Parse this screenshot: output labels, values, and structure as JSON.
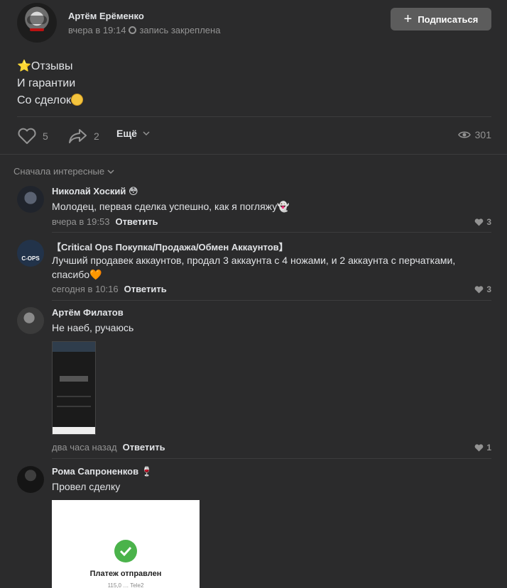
{
  "post": {
    "author": "Артём Ерёменко",
    "time": "вчера в 19:14",
    "pinned": "запись закреплена",
    "subscribe_label": "Подписаться",
    "text_lines": [
      "⭐Отзывы",
      "И гарантии",
      "Со сделок"
    ],
    "likes": "5",
    "shares": "2",
    "more_label": "Ещё",
    "views": "301"
  },
  "sort_label": "Сначала интересные",
  "comments": [
    {
      "name": "Николай Хоский 😳",
      "text": "Молодец, первая сделка успешно, как я погляжу👻",
      "time": "вчера в 19:53",
      "reply": "Ответить",
      "likes": "3"
    },
    {
      "name": "【Critical Ops Покупка/Продажа/Обмен Аккаунтов】",
      "text": "Лучший продавек аккаунтов, продал 3 аккаунта с 4 ножами, и 2 аккаунта с перчатками, спасибо🧡",
      "time": "сегодня в 10:16",
      "reply": "Ответить",
      "likes": "3",
      "avatar_text": "C-OPS"
    },
    {
      "name": "Артём Филатов",
      "text": "Не наеб, ручаюсь",
      "time": "два часа назад",
      "reply": "Ответить",
      "likes": "1"
    },
    {
      "name": "Рома Сапроненков 🍷",
      "text": "Провел сделку",
      "image_title": "Платеж отправлен",
      "image_sub": "115,0 … Tele2"
    }
  ],
  "colors": {
    "background": "#2b2b2c",
    "text": "#e1e3e6",
    "muted": "#939393",
    "button": "#5c5c5c"
  }
}
